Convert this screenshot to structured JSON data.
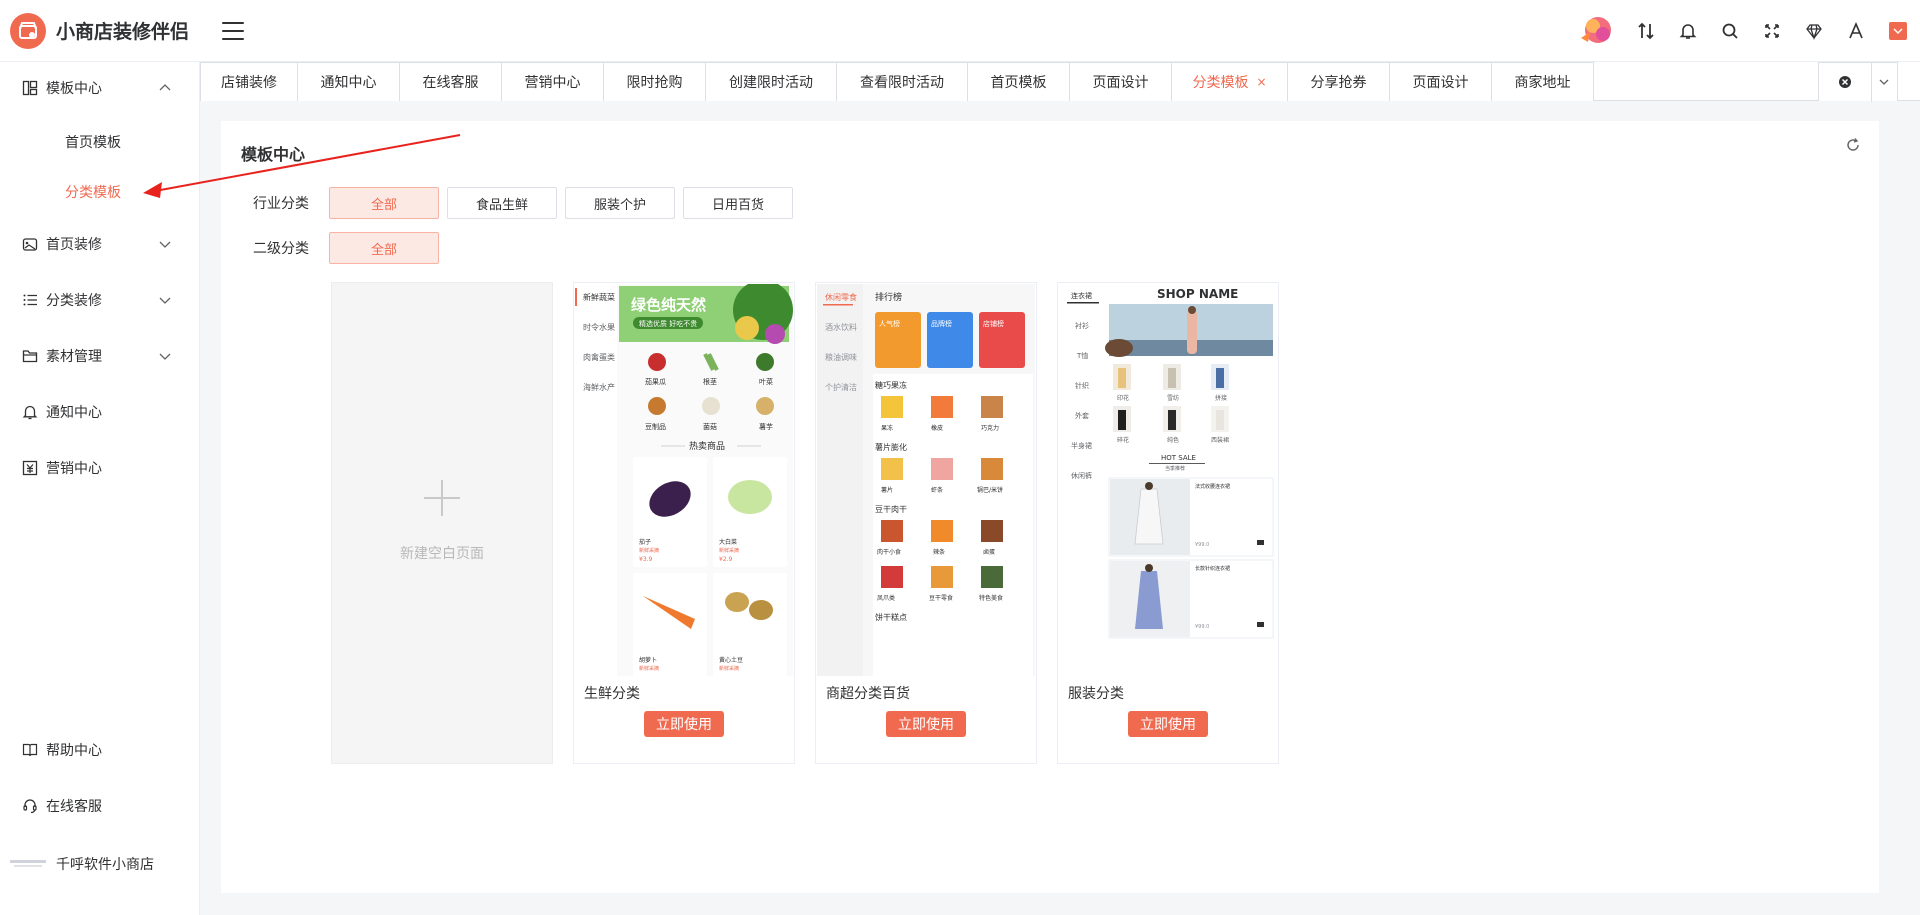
{
  "brand": {
    "name": "小商店装修伴侣",
    "accent": "#f06a50"
  },
  "header_tools": [
    "avatar-icon",
    "sort-icon",
    "bell-icon",
    "search-icon",
    "fullscreen-icon",
    "diamond-icon",
    "font-icon",
    "user-box-icon"
  ],
  "sidebar": {
    "items": [
      {
        "label": "模板中心",
        "icon": "layout-icon"
      },
      {
        "label": "首页模板"
      },
      {
        "label": "分类模板"
      },
      {
        "label": "首页装修",
        "icon": "palette-icon"
      },
      {
        "label": "分类装修",
        "icon": "list-icon"
      },
      {
        "label": "素材管理",
        "icon": "folder-icon"
      },
      {
        "label": "通知中心",
        "icon": "bell-icon"
      },
      {
        "label": "营销中心",
        "icon": "marketing-icon"
      }
    ],
    "footer": [
      {
        "label": "帮助中心",
        "icon": "book-icon"
      },
      {
        "label": "在线客服",
        "icon": "service-icon"
      },
      {
        "label": "千呼软件小商店",
        "icon": "shop-logo-icon"
      }
    ]
  },
  "tabs": [
    {
      "label": "店铺装修"
    },
    {
      "label": "通知中心"
    },
    {
      "label": "在线客服"
    },
    {
      "label": "营销中心"
    },
    {
      "label": "限时抢购"
    },
    {
      "label": "创建限时活动"
    },
    {
      "label": "查看限时活动"
    },
    {
      "label": "首页模板"
    },
    {
      "label": "页面设计"
    },
    {
      "label": "分类模板",
      "close": "×"
    },
    {
      "label": "分享抢券"
    },
    {
      "label": "页面设计"
    },
    {
      "label": "商家地址"
    }
  ],
  "panel": {
    "title": "模板中心",
    "filters": {
      "industry": {
        "label": "行业分类",
        "options": [
          "全部",
          "食品生鲜",
          "服装个护",
          "日用百货"
        ]
      },
      "secondary": {
        "label": "二级分类",
        "options": [
          "全部"
        ]
      }
    },
    "blank_card": "新建空白页面",
    "use_label": "立即使用",
    "templates": [
      {
        "title": "生鲜分类",
        "preview": {
          "side": [
            "新鲜蔬菜",
            "时令水果",
            "肉禽蛋类",
            "海鲜水产"
          ],
          "banner": "绿色纯天然",
          "banner_sub": "精选优质 好吃不贵",
          "cats": [
            "茄果瓜",
            "根茎",
            "叶菜",
            "豆制品",
            "菌菇",
            "薯芋"
          ],
          "hot": "热卖商品",
          "products": [
            {
              "name": "茄子",
              "tag": "新鲜采摘",
              "price": "¥3.9"
            },
            {
              "name": "大白菜",
              "tag": "新鲜采摘",
              "price": "¥2.9"
            },
            {
              "name": "胡萝卜",
              "tag": "新鲜采摘"
            },
            {
              "name": "黄心土豆",
              "tag": "新鲜采摘"
            }
          ]
        }
      },
      {
        "title": "商超分类百货",
        "preview": {
          "side": [
            "休闲零食",
            "酒水饮料",
            "粮油调味",
            "个护清洁"
          ],
          "rank_title": "排行榜",
          "ranks": [
            "人气榜",
            "品牌榜",
            "店铺榜"
          ],
          "groups": [
            {
              "title": "糖巧果冻",
              "items": [
                "果冻",
                "橡皮",
                "巧克力"
              ]
            },
            {
              "title": "薯片膨化",
              "items": [
                "薯片",
                "虾条",
                "锅巴/米饼"
              ]
            },
            {
              "title": "豆干肉干",
              "items": [
                "肉干小食",
                "辣条",
                "卤蛋"
              ]
            },
            {
              "title": "",
              "items": [
                "凤爪类",
                "豆干零食",
                "特色美食"
              ]
            }
          ],
          "footer": "饼干糕点"
        }
      },
      {
        "title": "服装分类",
        "preview": {
          "side": [
            "连衣裙",
            "衬衫",
            "T恤",
            "针织",
            "外套",
            "半身裙",
            "休闲裤"
          ],
          "shop_name": "SHOP NAME",
          "clothes": [
            "印花",
            "雪纺",
            "拼接",
            "碎花",
            "纯色",
            "西装裙"
          ],
          "hot_sale": "HOT SALE",
          "hot_sub": "当季推荐",
          "item1": "法式收腰连衣裙",
          "item2": "长款针织连衣裙",
          "buy": "¥99.0"
        }
      }
    ]
  }
}
